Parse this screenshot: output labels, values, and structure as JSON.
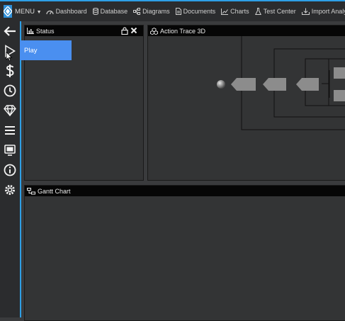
{
  "topbar": {
    "menu_label": "MENU",
    "nav": [
      {
        "label": "Dashboard",
        "icon": "dashboard-icon"
      },
      {
        "label": "Database",
        "icon": "database-icon"
      },
      {
        "label": "Diagrams",
        "icon": "diagrams-icon"
      },
      {
        "label": "Documents",
        "icon": "documents-icon"
      },
      {
        "label": "Charts",
        "icon": "charts-icon"
      },
      {
        "label": "Test Center",
        "icon": "flask-icon"
      },
      {
        "label": "Import Analyzer",
        "icon": "import-analyzer-icon"
      }
    ]
  },
  "sidebar": {
    "items": [
      {
        "name": "back",
        "icon": "arrow-left-icon"
      },
      {
        "name": "play",
        "icon": "play-icon"
      },
      {
        "name": "cost",
        "icon": "dollar-icon"
      },
      {
        "name": "history",
        "icon": "clock-icon"
      },
      {
        "name": "value",
        "icon": "diamond-icon"
      },
      {
        "name": "list",
        "icon": "hamburger-icon"
      },
      {
        "name": "monitor",
        "icon": "monitor-icon"
      },
      {
        "name": "info",
        "icon": "info-icon"
      },
      {
        "name": "settings",
        "icon": "gear-icon"
      }
    ],
    "tooltip": "Play"
  },
  "panels": {
    "status": {
      "title": "Status"
    },
    "action_trace": {
      "title": "Action Trace 3D"
    },
    "gantt": {
      "title": "Gantt Chart"
    }
  },
  "colors": {
    "accent": "#2e9fe6",
    "tooltip": "#4a8ff0",
    "panel_header": "#060606",
    "panel_body": "#333435"
  }
}
